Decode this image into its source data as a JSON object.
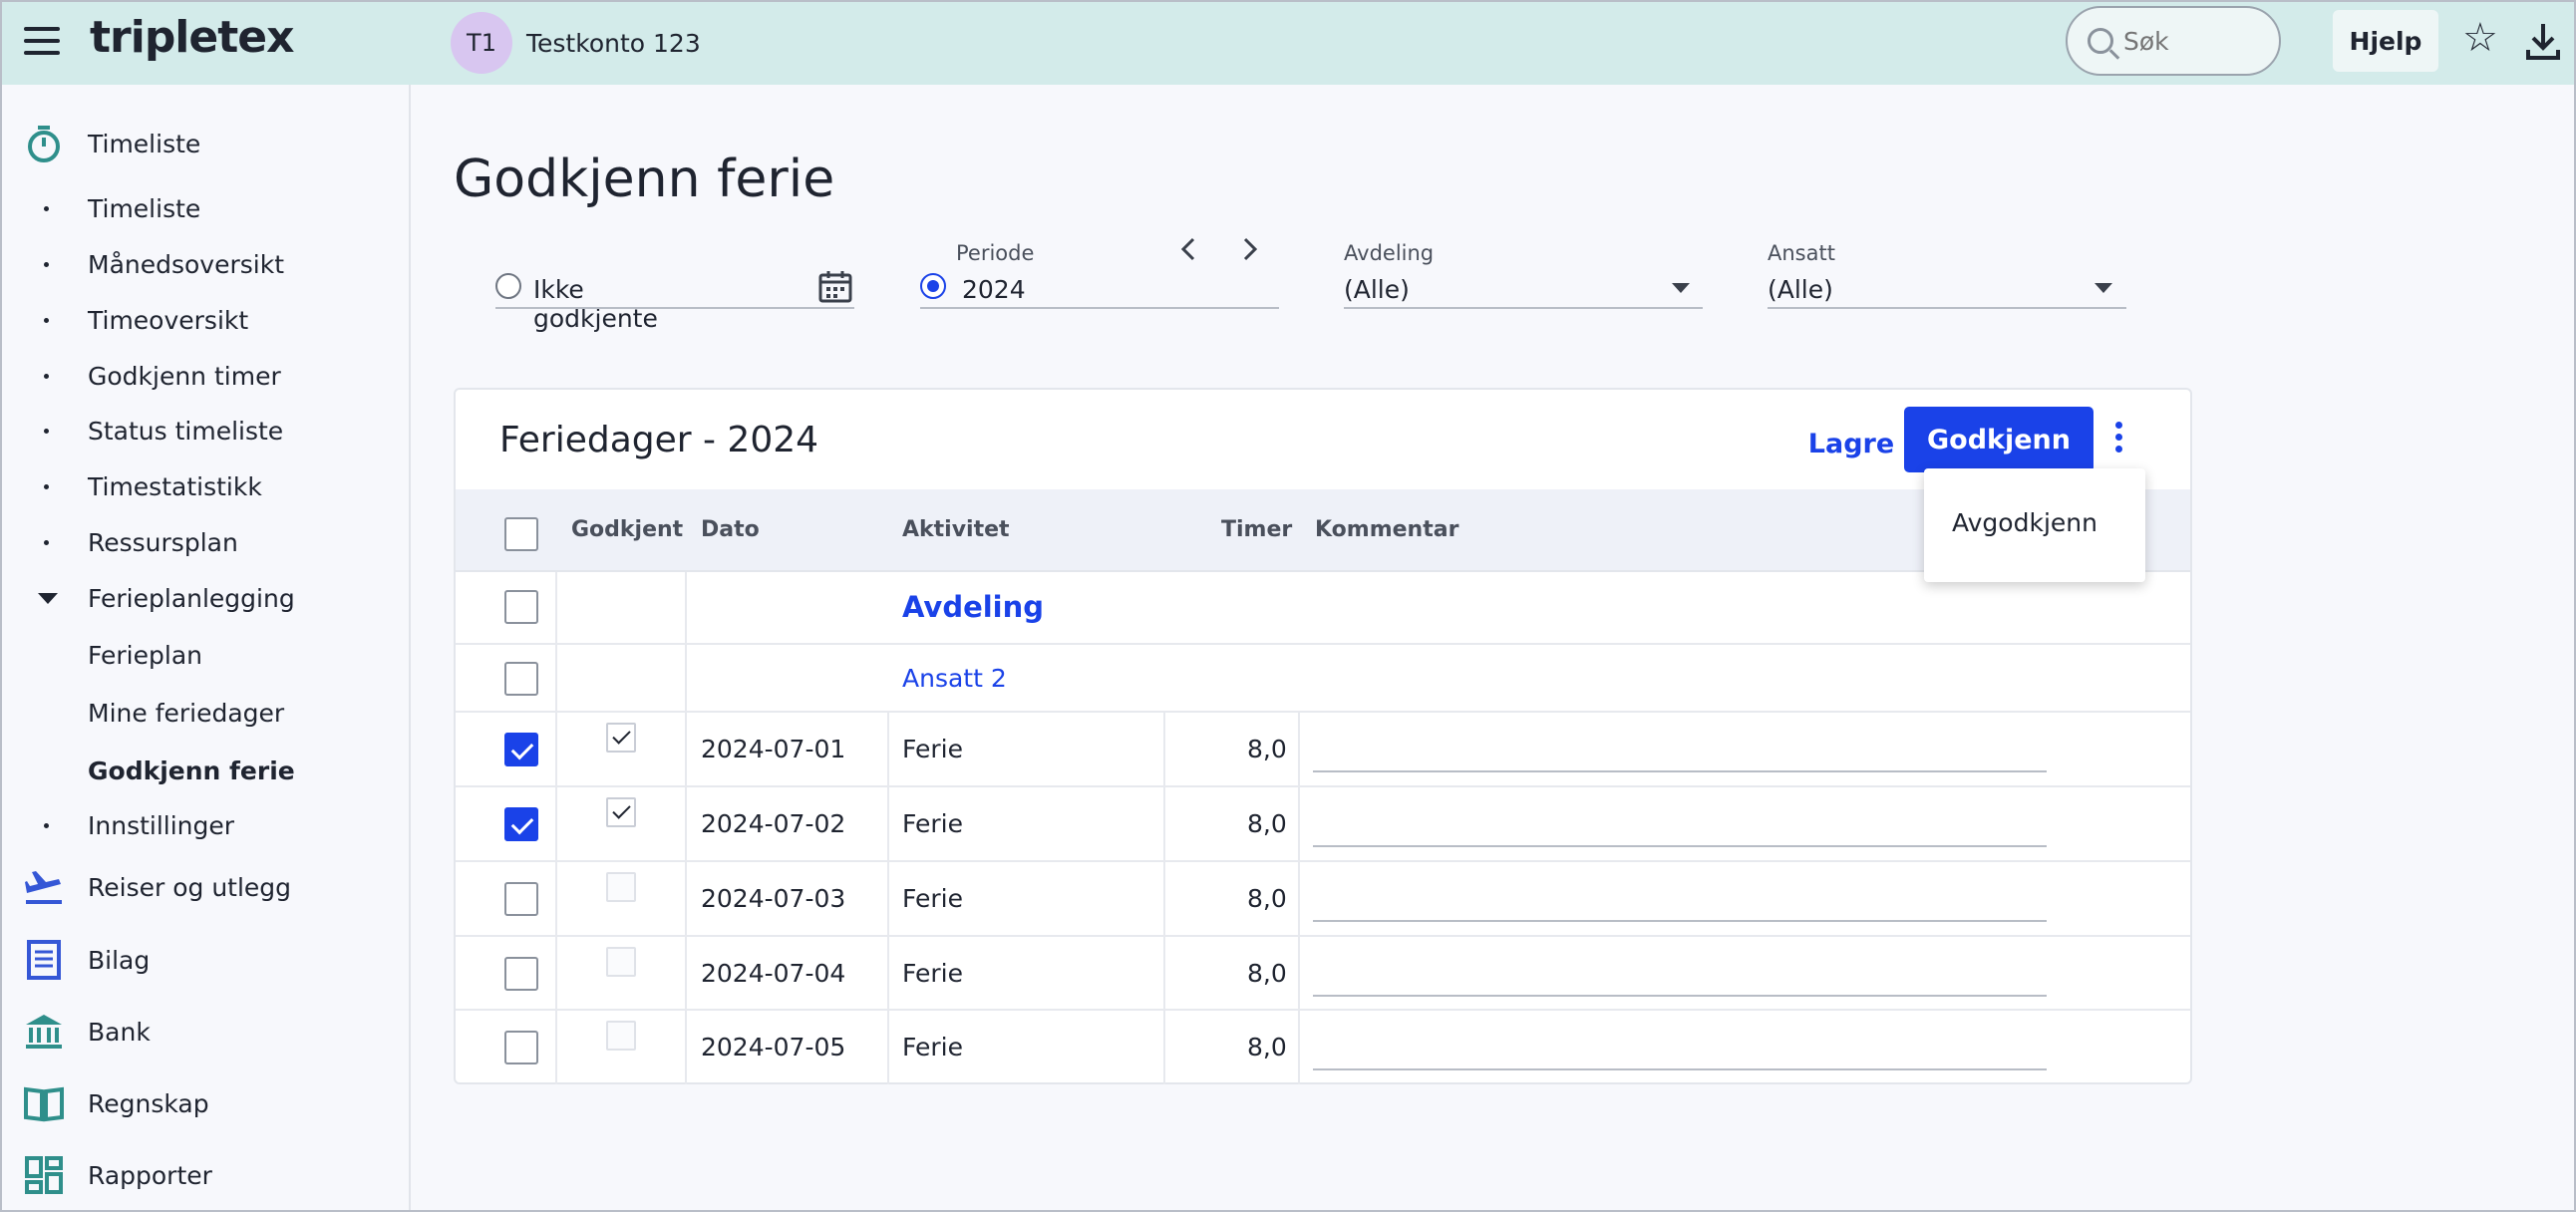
{
  "topbar": {
    "brand": "tripletex",
    "account_initials": "T1",
    "account_name": "Testkonto 123",
    "search_placeholder": "Søk",
    "help_label": "Hjelp"
  },
  "sidebar": {
    "sections": [
      {
        "label": "Timeliste",
        "icon": "stopwatch-icon"
      },
      {
        "label": "Reiser og utlegg",
        "icon": "airplane-icon"
      },
      {
        "label": "Bilag",
        "icon": "receipt-icon"
      },
      {
        "label": "Bank",
        "icon": "bank-icon"
      },
      {
        "label": "Regnskap",
        "icon": "book-icon"
      },
      {
        "label": "Rapporter",
        "icon": "dashboard-icon"
      }
    ],
    "timeliste_items": [
      "Timeliste",
      "Månedsoversikt",
      "Timeoversikt",
      "Godkjenn timer",
      "Status timeliste",
      "Timestatistikk",
      "Ressursplan",
      "Ferieplanlegging",
      "Innstillinger"
    ],
    "ferie_items": [
      "Ferieplan",
      "Mine feriedager",
      "Godkjenn ferie"
    ],
    "active_item": "Godkjenn ferie"
  },
  "page": {
    "title": "Godkjenn ferie"
  },
  "filters": {
    "ikke_godkjente_label": "Ikke godkjente",
    "periode_label": "Periode",
    "periode_value": "2024",
    "avdeling_label": "Avdeling",
    "avdeling_value": "(Alle)",
    "ansatt_label": "Ansatt",
    "ansatt_value": "(Alle)"
  },
  "card": {
    "title": "Feriedager - 2024",
    "lagre_label": "Lagre",
    "godkjenn_label": "Godkjenn",
    "menu_item": "Avgodkjenn",
    "columns": [
      "Godkjent",
      "Dato",
      "Aktivitet",
      "Timer",
      "Kommentar"
    ],
    "group_label": "Avdeling",
    "employee_label": "Ansatt 2",
    "rows": [
      {
        "date": "2024-07-01",
        "activity": "Ferie",
        "hours": "8,0",
        "selected": true,
        "approved": true
      },
      {
        "date": "2024-07-02",
        "activity": "Ferie",
        "hours": "8,0",
        "selected": true,
        "approved": true
      },
      {
        "date": "2024-07-03",
        "activity": "Ferie",
        "hours": "8,0",
        "selected": false,
        "approved": false
      },
      {
        "date": "2024-07-04",
        "activity": "Ferie",
        "hours": "8,0",
        "selected": false,
        "approved": false
      },
      {
        "date": "2024-07-05",
        "activity": "Ferie",
        "hours": "8,0",
        "selected": false,
        "approved": false
      }
    ]
  },
  "colors": {
    "topbar_bg": "#d3ebea",
    "primary": "#1a42e8",
    "avatar_bg": "#d8c6f0",
    "sidebar_icon_teal": "#2f8f8b",
    "sidebar_icon_blue": "#3557d6"
  }
}
